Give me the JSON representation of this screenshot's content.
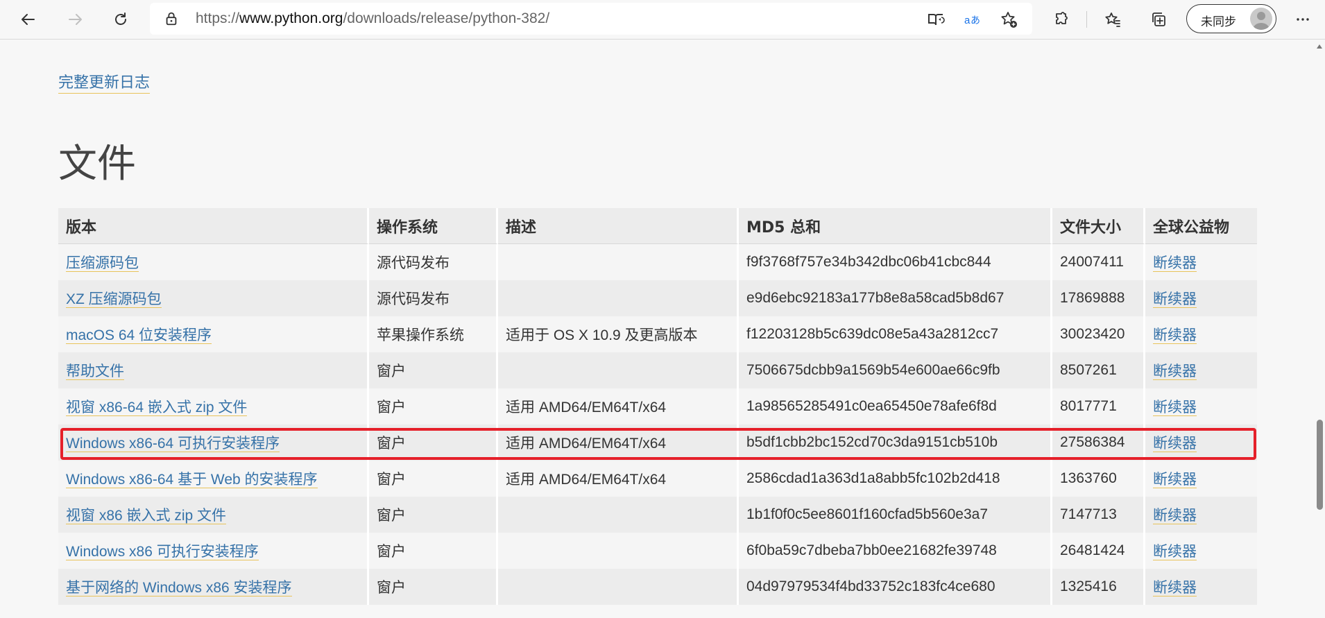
{
  "browser": {
    "url_prefix": "https://",
    "url_host": "www.python.org",
    "url_path": "/downloads/release/python-382/",
    "profile_label": "未同步"
  },
  "page": {
    "changelog_link": "完整更新日志",
    "section_title": "文件"
  },
  "table": {
    "headers": [
      "版本",
      "操作系统",
      "描述",
      "MD5 总和",
      "文件大小",
      "全球公益物"
    ],
    "rows": [
      {
        "version": "压缩源码包",
        "os": "源代码发布",
        "desc": "",
        "md5": "f9f3768f757e34b342dbc06b41cbc844",
        "size": "24007411",
        "sig": "断续器"
      },
      {
        "version": "XZ 压缩源码包",
        "os": "源代码发布",
        "desc": "",
        "md5": "e9d6ebc92183a177b8e8a58cad5b8d67",
        "size": "17869888",
        "sig": "断续器"
      },
      {
        "version": "macOS 64 位安装程序",
        "os": "苹果操作系统",
        "desc": "适用于 OS X 10.9 及更高版本",
        "md5": "f12203128b5c639dc08e5a43a2812cc7",
        "size": "30023420",
        "sig": "断续器"
      },
      {
        "version": "帮助文件",
        "os": "窗户",
        "desc": "",
        "md5": "7506675dcbb9a1569b54e600ae66c9fb",
        "size": "8507261",
        "sig": "断续器"
      },
      {
        "version": "视窗 x86-64 嵌入式 zip 文件",
        "os": "窗户",
        "desc": "适用 AMD64/EM64T/x64",
        "md5": "1a98565285491c0ea65450e78afe6f8d",
        "size": "8017771",
        "sig": "断续器"
      },
      {
        "version": "Windows x86-64 可执行安装程序",
        "os": "窗户",
        "desc": "适用 AMD64/EM64T/x64",
        "md5": "b5df1cbb2bc152cd70c3da9151cb510b",
        "size": "27586384",
        "sig": "断续器"
      },
      {
        "version": "Windows x86-64 基于 Web 的安装程序",
        "os": "窗户",
        "desc": "适用 AMD64/EM64T/x64",
        "md5": "2586cdad1a363d1a8abb5fc102b2d418",
        "size": "1363760",
        "sig": "断续器"
      },
      {
        "version": "视窗 x86 嵌入式 zip 文件",
        "os": "窗户",
        "desc": "",
        "md5": "1b1f0f0c5ee8601f160cfad5b560e3a7",
        "size": "7147713",
        "sig": "断续器"
      },
      {
        "version": "Windows x86 可执行安装程序",
        "os": "窗户",
        "desc": "",
        "md5": "6f0ba59c7dbeba7bb0ee21682fe39748",
        "size": "26481424",
        "sig": "断续器"
      },
      {
        "version": "基于网络的 Windows x86 安装程序",
        "os": "窗户",
        "desc": "",
        "md5": "04d97979534f4bd33752c183fc4ce680",
        "size": "1325416",
        "sig": "断续器"
      }
    ],
    "highlighted_row": 5
  },
  "colors": {
    "link": "#3672a8",
    "link_underline": "#e8c35a",
    "highlight_border": "#e5202a"
  },
  "icons": [
    "back-icon",
    "forward-icon",
    "refresh-icon",
    "lock-icon",
    "immersive-reader-icon",
    "translate-icon",
    "add-favorite-icon",
    "extensions-icon",
    "favorites-icon",
    "collections-icon",
    "more-icon"
  ]
}
